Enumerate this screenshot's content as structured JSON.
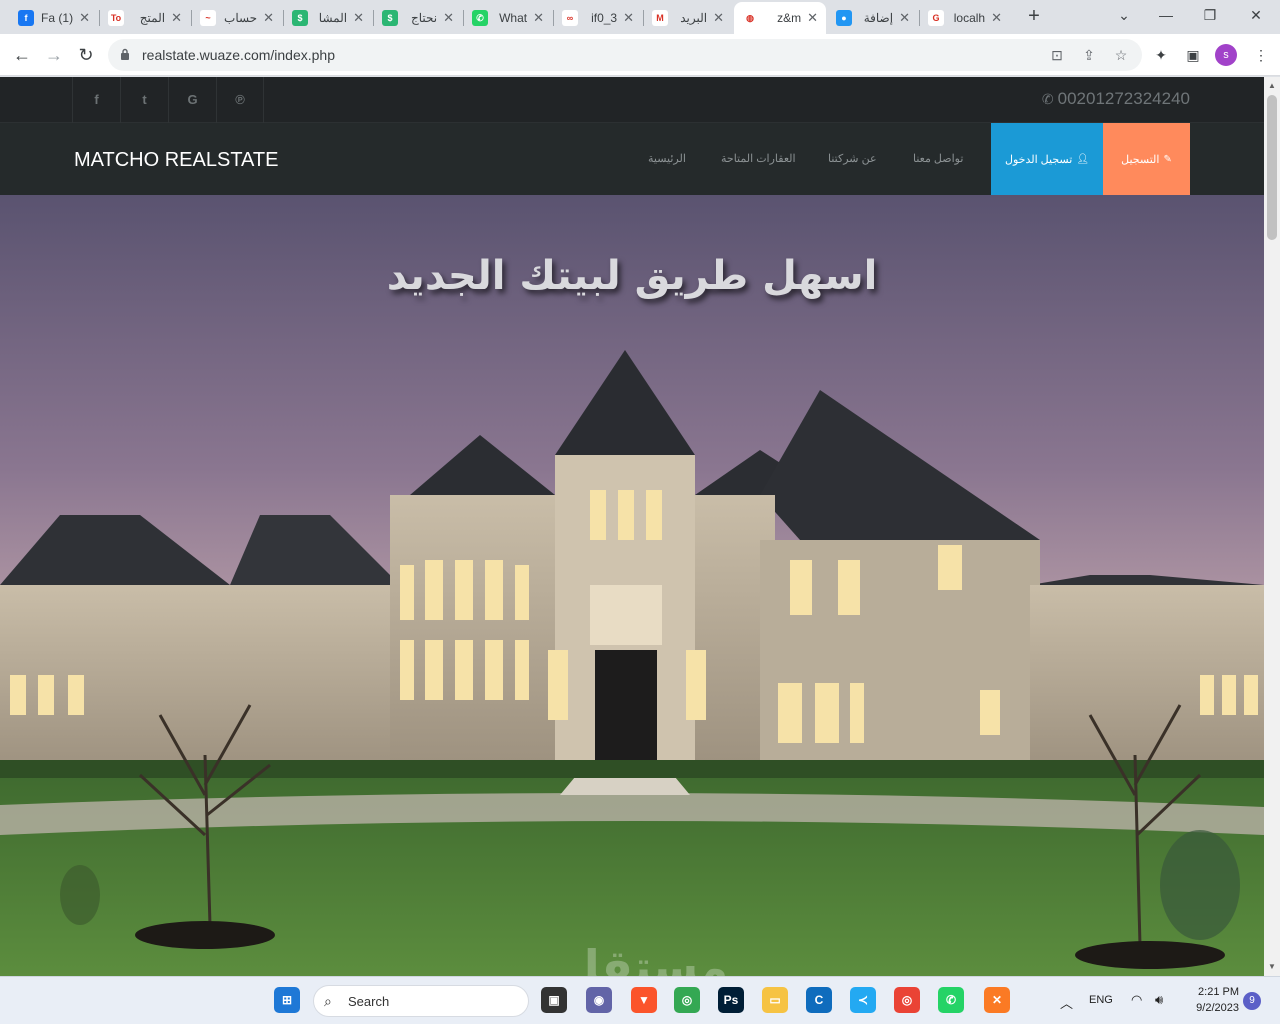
{
  "browser": {
    "tabs": [
      {
        "title": "(1) Fa",
        "favicon_color": "#1877f2",
        "favicon_text": "f"
      },
      {
        "title": "المتج",
        "favicon_color": "#ffffff",
        "favicon_text": "To"
      },
      {
        "title": "حساب",
        "favicon_color": "#ffffff",
        "favicon_text": "~"
      },
      {
        "title": "المشا",
        "favicon_color": "#2bb673",
        "favicon_text": "$"
      },
      {
        "title": "نحتاج",
        "favicon_color": "#2bb673",
        "favicon_text": "$"
      },
      {
        "title": "What",
        "favicon_color": "#25d366",
        "favicon_text": "✆"
      },
      {
        "title": "if0_3",
        "favicon_color": "#ffffff",
        "favicon_text": "∞"
      },
      {
        "title": "البريد",
        "favicon_color": "#ffffff",
        "favicon_text": "M"
      },
      {
        "title": "z&m",
        "favicon_color": "#ffffff",
        "favicon_text": "◍"
      },
      {
        "title": "إضافة",
        "favicon_color": "#2196f3",
        "favicon_text": "●"
      },
      {
        "title": "localh",
        "favicon_color": "#ffffff",
        "favicon_text": "G"
      }
    ],
    "active_tab_index": 8,
    "new_tab_label": "+",
    "url": "realstate.wuaze.com/index.php",
    "profile_initial": "s",
    "window_controls": {
      "minimize": "⌄",
      "minimize2": "—",
      "restore": "❐",
      "close": "✕"
    }
  },
  "site": {
    "topbar": {
      "social_icons": [
        {
          "name": "facebook-icon",
          "glyph": "f"
        },
        {
          "name": "twitter-icon",
          "glyph": "t"
        },
        {
          "name": "google-icon",
          "glyph": "G"
        },
        {
          "name": "pinterest-icon",
          "glyph": "℗"
        }
      ],
      "phone": "00201272324240"
    },
    "navbar": {
      "brand": "MATCHO REALSTATE",
      "links": [
        "الرئيسية",
        "العقارات المتاحة",
        "عن شركتنا",
        "تواصل معنا"
      ],
      "login_label": "تسجيل الدخول",
      "register_label": "التسجيل"
    },
    "hero": {
      "title": "اسهل طريق لبيتك الجديد",
      "watermark": "مستقل"
    }
  },
  "taskbar": {
    "search_label": "Search",
    "apps": [
      {
        "name": "windows-start-icon",
        "color": "#1e78d6",
        "glyph": "⊞"
      },
      {
        "name": "task-view-icon",
        "color": "#333333",
        "glyph": "▣"
      },
      {
        "name": "teams-icon",
        "color": "#6264a7",
        "glyph": "◉"
      },
      {
        "name": "brave-icon",
        "color": "#fb542b",
        "glyph": "▼"
      },
      {
        "name": "chrome-icon",
        "color": "#34a853",
        "glyph": "◎"
      },
      {
        "name": "photoshop-icon",
        "color": "#001e36",
        "glyph": "Ps"
      },
      {
        "name": "file-explorer-icon",
        "color": "#f6c343",
        "glyph": "▭"
      },
      {
        "name": "cortana-icon",
        "color": "#0f6cbd",
        "glyph": "C"
      },
      {
        "name": "vscode-icon",
        "color": "#23a9f2",
        "glyph": "≺"
      },
      {
        "name": "chrome-profile-icon",
        "color": "#ea4335",
        "glyph": "◎"
      },
      {
        "name": "whatsapp-icon",
        "color": "#25d366",
        "glyph": "✆"
      },
      {
        "name": "xampp-icon",
        "color": "#fb7a24",
        "glyph": "✕"
      }
    ],
    "language": "ENG",
    "time": "2:21 PM",
    "date": "9/2/2023",
    "notifications": "9"
  }
}
